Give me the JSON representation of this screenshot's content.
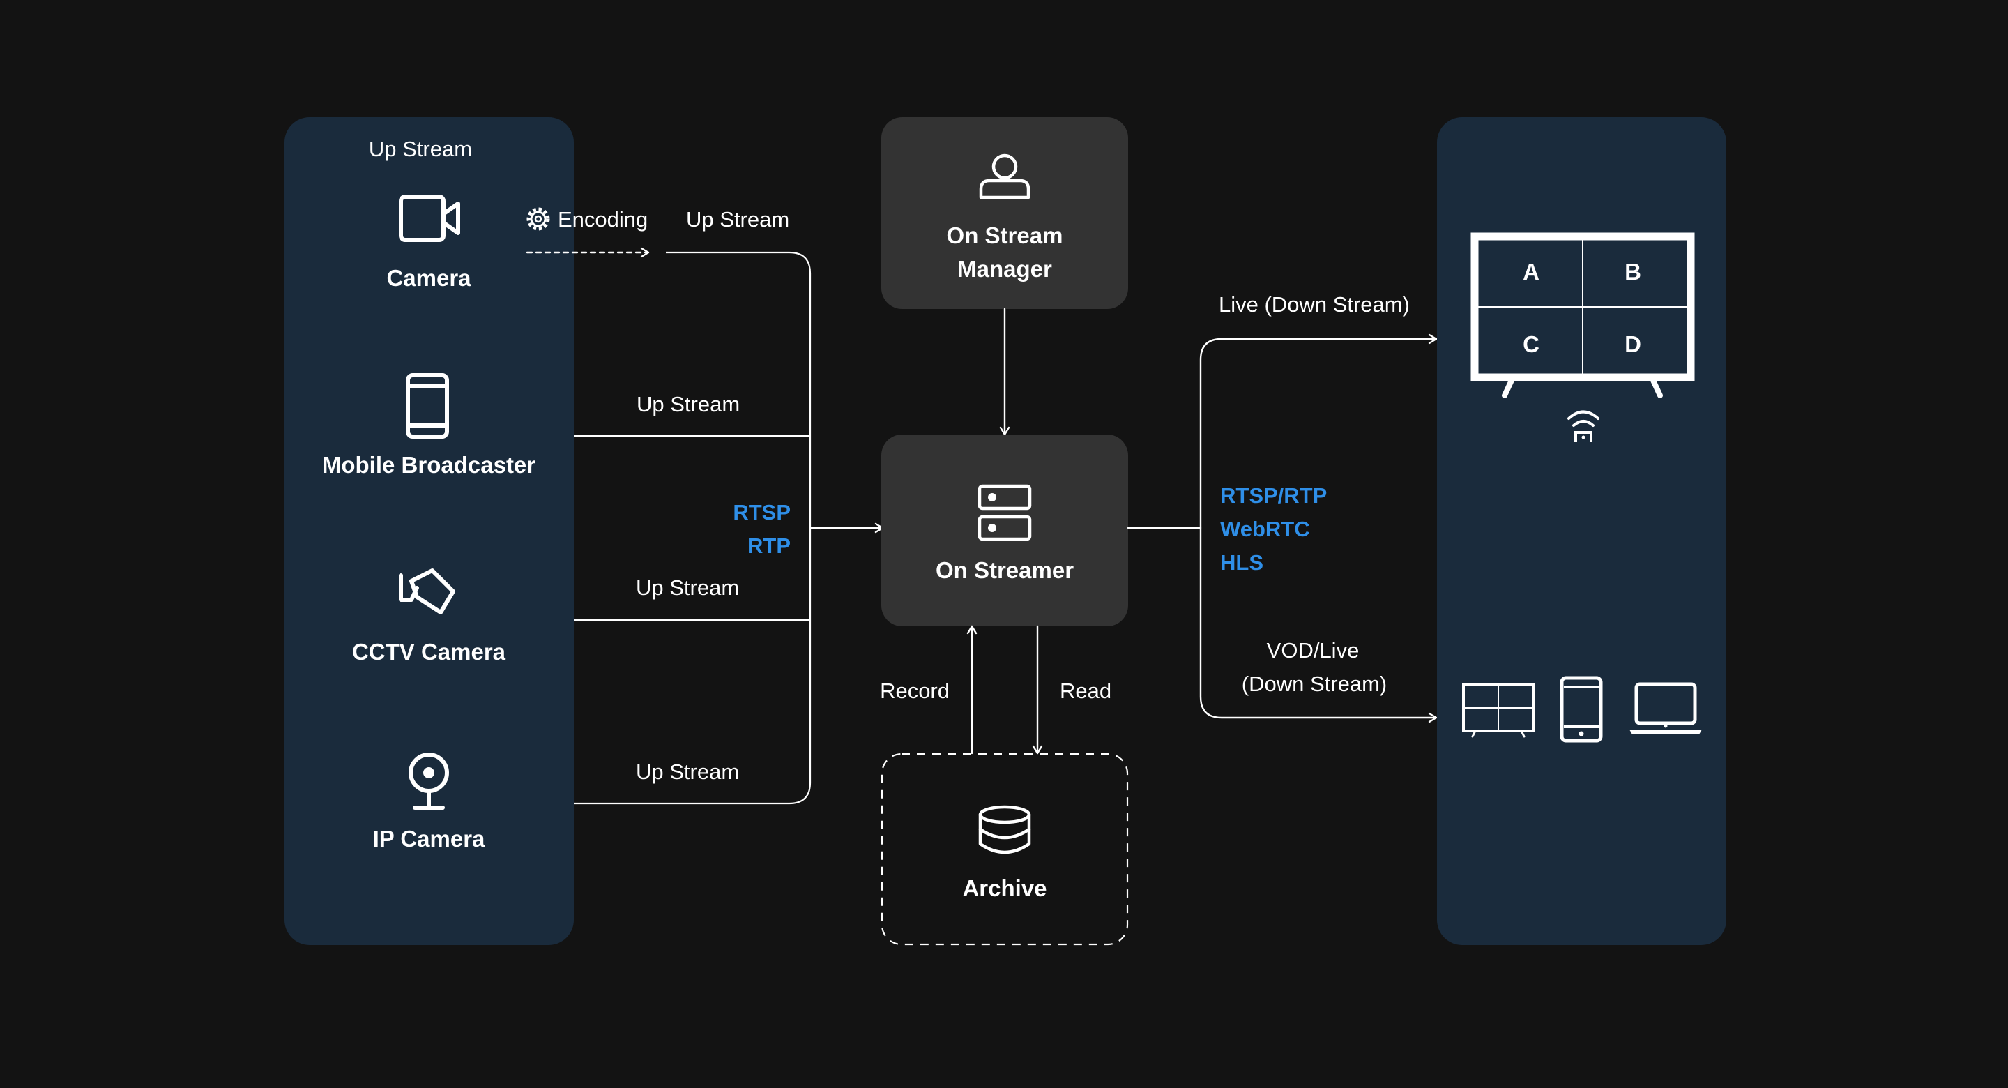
{
  "left_panel": {
    "header": "Up Stream",
    "sources": [
      {
        "label": "Camera",
        "icon": "video-camera-icon"
      },
      {
        "label": "Mobile Broadcaster",
        "icon": "smartphone-icon"
      },
      {
        "label": "CCTV Camera",
        "icon": "cctv-camera-icon"
      },
      {
        "label": "IP Camera",
        "icon": "ip-camera-icon"
      }
    ]
  },
  "connections": {
    "encoding": "Encoding",
    "up_stream_labels": [
      "Up Stream",
      "Up Stream",
      "Up Stream",
      "Up Stream"
    ],
    "ingest_protocols": [
      "RTSP",
      "RTP"
    ],
    "egress_protocols": [
      "RTSP/RTP",
      "WebRTC",
      "HLS"
    ],
    "live_label": "Live (Down Stream)",
    "vod_label_lines": [
      "VOD/Live",
      "(Down Stream)"
    ],
    "record_label": "Record",
    "read_label": "Read"
  },
  "nodes": {
    "manager": {
      "lines": [
        "On Stream",
        "Manager"
      ],
      "icon": "user-icon"
    },
    "streamer": {
      "label": "On Streamer",
      "icon": "server-icon"
    },
    "archive": {
      "label": "Archive",
      "icon": "database-icon"
    }
  },
  "right_panel": {
    "multiview_cells": [
      "A",
      "B",
      "C",
      "D"
    ],
    "devices": [
      "tv-icon",
      "smartphone-icon",
      "laptop-icon"
    ]
  },
  "colors": {
    "background": "#131313",
    "panel": "#1a2b3c",
    "node": "#333333",
    "accent": "#2f8fe8"
  }
}
